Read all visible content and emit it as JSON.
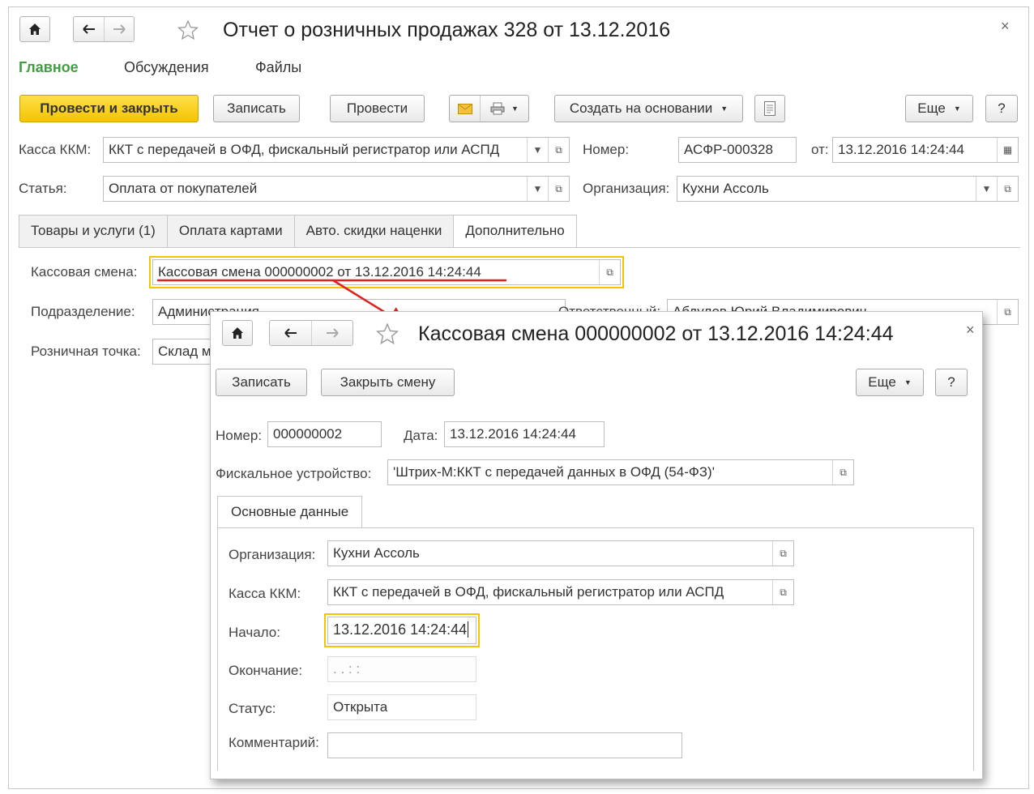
{
  "window": {
    "title": "Отчет о розничных продажах 328 от 13.12.2016",
    "close": "×",
    "sections": [
      "Главное",
      "Обсуждения",
      "Файлы"
    ]
  },
  "toolbar": {
    "post_close": "Провести и закрыть",
    "save": "Записать",
    "post": "Провести",
    "create_based": "Создать на основании",
    "more": "Еще",
    "help": "?"
  },
  "header": {
    "kassa_label": "Касса ККМ:",
    "kassa_value": "ККТ с передачей в ОФД, фискальный регистратор или АСПД",
    "number_label": "Номер:",
    "number_value": "АСФР-000328",
    "from_label": "от:",
    "from_value": "13.12.2016 14:24:44",
    "article_label": "Статья:",
    "article_value": "Оплата от покупателей",
    "org_label": "Организация:",
    "org_value": "Кухни Ассоль"
  },
  "tabs": [
    "Товары и услуги (1)",
    "Оплата картами",
    "Авто. скидки наценки",
    "Дополнительно"
  ],
  "extra": {
    "shift_label": "Кассовая смена:",
    "shift_value": "Кассовая смена 000000002 от 13.12.2016 14:24:44",
    "division_label": "Подразделение:",
    "division_value": "Администрация",
    "responsible_label": "Ответственный:",
    "responsible_value": "Абдулов Юрий Владимирович",
    "retail_label": "Розничная точка:",
    "retail_value": "Склад магазина"
  },
  "popup": {
    "title": "Кассовая смена 000000002 от 13.12.2016 14:24:44",
    "close": "×",
    "save": "Записать",
    "close_shift": "Закрыть смену",
    "more": "Еще",
    "help": "?",
    "number_label": "Номер:",
    "number_value": "000000002",
    "date_label": "Дата:",
    "date_value": "13.12.2016 14:24:44",
    "device_label": "Фискальное устройство:",
    "device_value": "'Штрих-М:ККТ с передачей данных в ОФД (54-ФЗ)'",
    "tab": "Основные данные",
    "org_label": "Организация:",
    "org_value": "Кухни Ассоль",
    "kassa_label": "Касса ККМ:",
    "kassa_value": "ККТ с передачей в ОФД, фискальный регистратор или АСПД",
    "start_label": "Начало:",
    "start_value": "13.12.2016 14:24:44",
    "end_label": "Окончание:",
    "end_value": ". .     : :",
    "status_label": "Статус:",
    "status_value": "Открыта",
    "comment_label": "Комментарий:",
    "comment_value": ""
  },
  "colors": {
    "accent_green": "#3f9e3f",
    "primary_yellow": "#f5c400",
    "highlight": "#f3c400",
    "annotation_red": "#e02020"
  },
  "icons": [
    "home-icon",
    "arrow-left-icon",
    "arrow-right-icon",
    "star-icon",
    "mail-icon",
    "print-icon",
    "report-icon",
    "open-icon",
    "dropdown-icon",
    "calendar-icon"
  ]
}
